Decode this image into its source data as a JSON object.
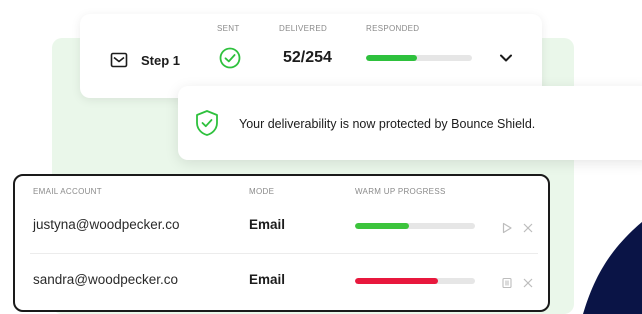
{
  "step": {
    "columns": {
      "sent": "SENT",
      "delivered": "DELIVERED",
      "responded": "RESPONDED"
    },
    "label": "Step 1",
    "delivered_value": "52/254",
    "responded_progress": 0.48,
    "colors": {
      "accent": "#2ec13d",
      "track": "#e6e6e6"
    }
  },
  "shield_banner": {
    "text": "Your deliverability is now protected by Bounce Shield.",
    "icon": "shield-check-icon"
  },
  "accounts": {
    "headers": {
      "email": "EMAIL ACCOUNT",
      "mode": "MODE",
      "progress": "WARM UP PROGRESS"
    },
    "rows": [
      {
        "email": "justyna@woodpecker.co",
        "mode": "Email",
        "progress": 0.45,
        "color": "#3cc43c",
        "action_icon": "play-icon"
      },
      {
        "email": "sandra@woodpecker.co",
        "mode": "Email",
        "progress": 0.69,
        "color": "#e8183d",
        "action_icon": "pause-icon"
      }
    ]
  },
  "decor": {
    "navy": "#0a1446"
  }
}
